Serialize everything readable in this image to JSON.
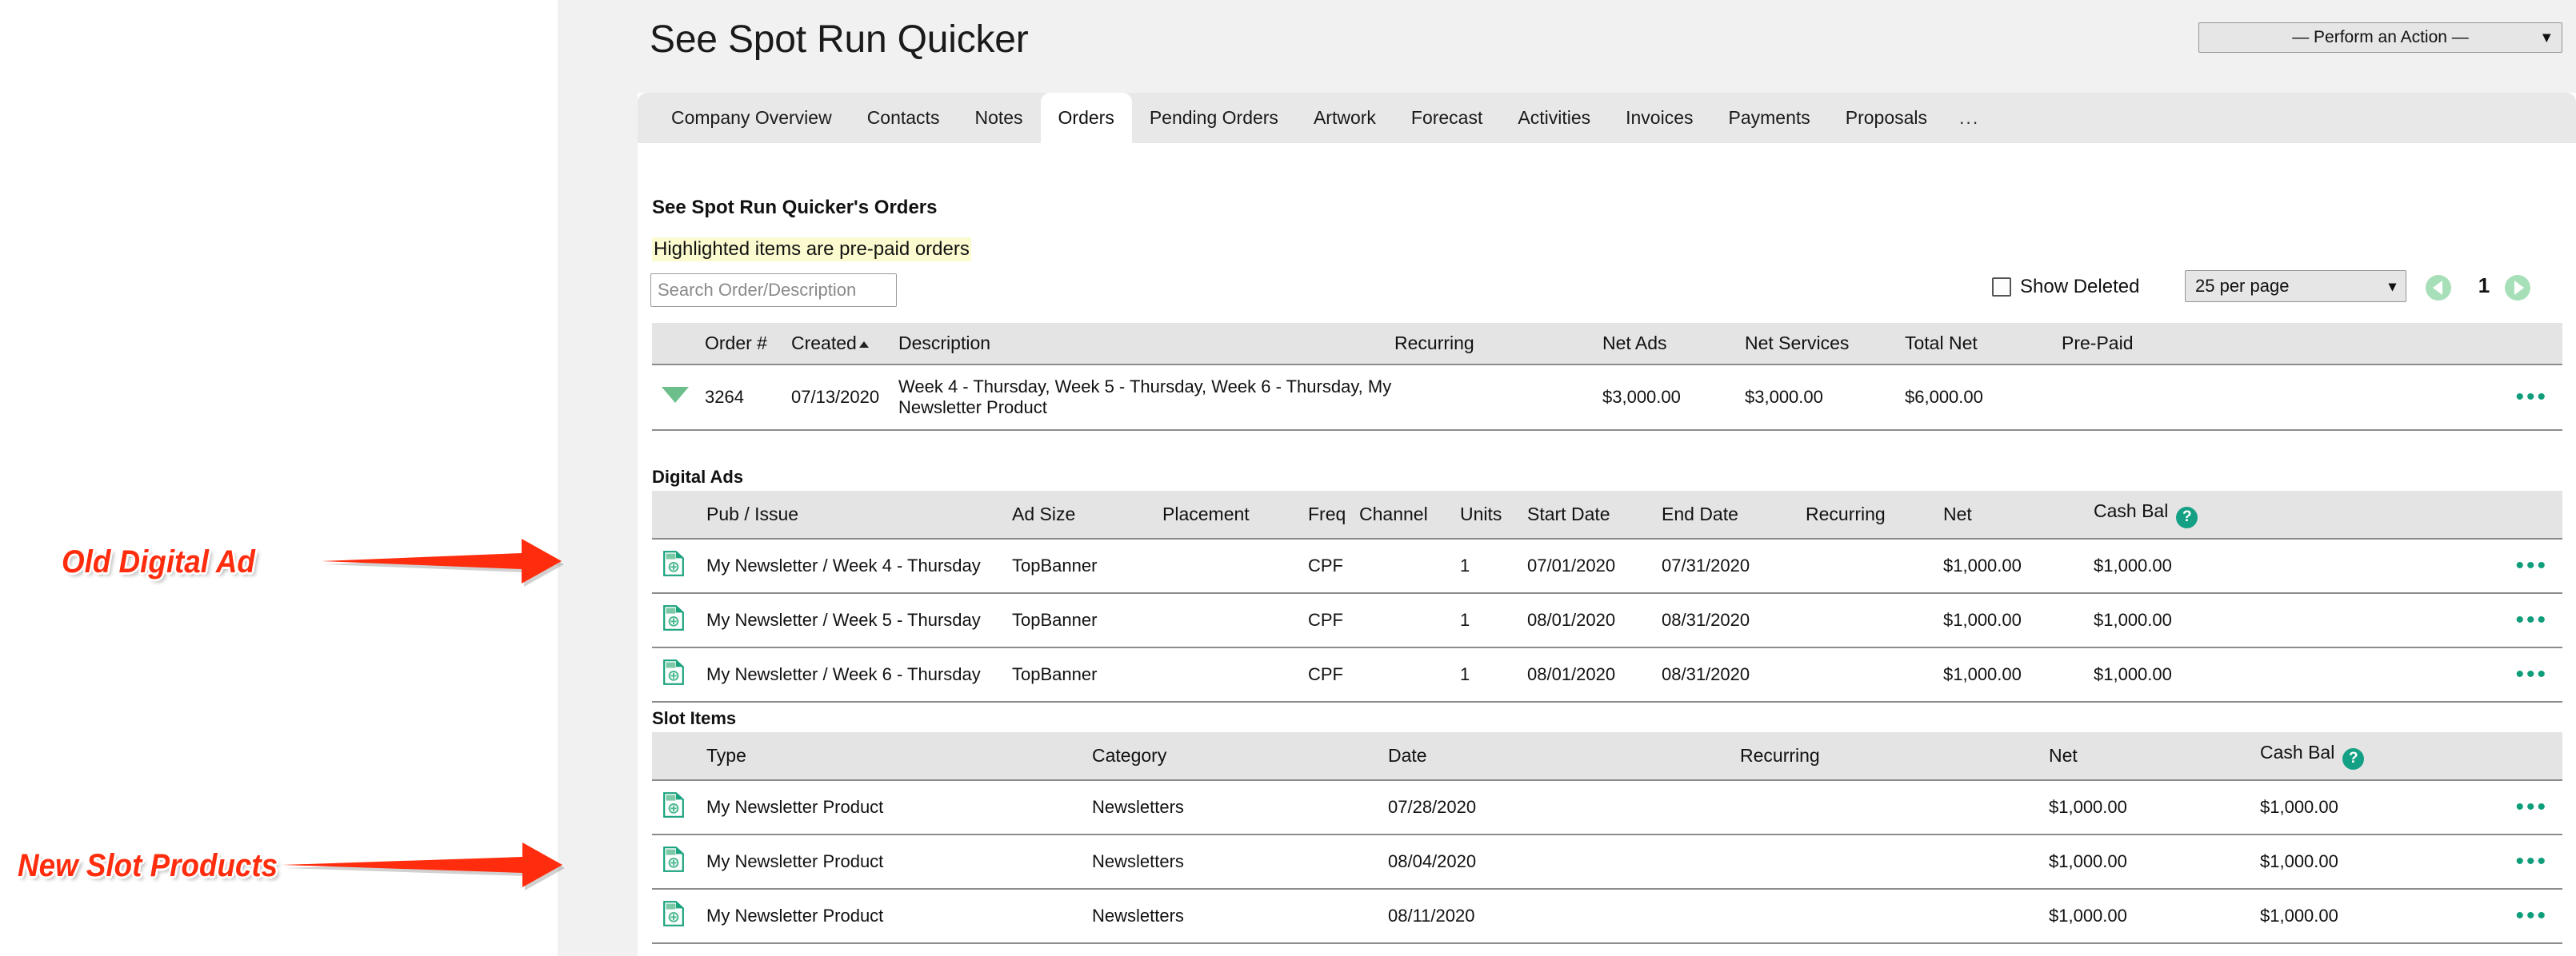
{
  "header": {
    "title": "See Spot Run Quicker",
    "action_select": {
      "value": "— Perform an Action —",
      "chevron": "chevron-down-icon"
    }
  },
  "tabs": [
    {
      "label": "Company Overview",
      "active": false
    },
    {
      "label": "Contacts",
      "active": false
    },
    {
      "label": "Notes",
      "active": false
    },
    {
      "label": "Orders",
      "active": true
    },
    {
      "label": "Pending Orders",
      "active": false
    },
    {
      "label": "Artwork",
      "active": false
    },
    {
      "label": "Forecast",
      "active": false
    },
    {
      "label": "Activities",
      "active": false
    },
    {
      "label": "Invoices",
      "active": false
    },
    {
      "label": "Payments",
      "active": false
    },
    {
      "label": "Proposals",
      "active": false
    },
    {
      "label": "...",
      "active": false
    }
  ],
  "orders_panel": {
    "heading": "See Spot Run Quicker's Orders",
    "prepaid_note": "Highlighted items are pre-paid orders",
    "search": {
      "value": "",
      "placeholder": "Search Order/Description"
    },
    "show_deleted_label": "Show Deleted",
    "per_page": "25 per page",
    "page_number": "1",
    "prev_label": "prev-page-arrow",
    "next_label": "next-page-arrow"
  },
  "orders_table": {
    "columns": [
      "",
      "Order #",
      "Created",
      "Description",
      "Recurring",
      "Net Ads",
      "Net Services",
      "Total Net",
      "Pre-Paid",
      ""
    ],
    "sorted_column": "Created",
    "rows": [
      {
        "order_no": "3264",
        "created": "07/13/2020",
        "description": "Week 4 - Thursday, Week 5 - Thursday, Week 6 - Thursday, My Newsletter Product",
        "recurring": "",
        "net_ads": "$3,000.00",
        "net_services": "$3,000.00",
        "total_net": "$6,000.00",
        "pre_paid": "",
        "actions": "•••"
      }
    ]
  },
  "digital_ads": {
    "section_label": "Digital Ads",
    "columns": [
      "",
      "Pub / Issue",
      "Ad Size",
      "Placement",
      "Freq",
      "Channel",
      "Units",
      "Start Date",
      "End Date",
      "Recurring",
      "Net",
      "Cash Bal",
      ""
    ],
    "cash_bal_help": "?",
    "rows": [
      {
        "icon": "document-add-icon",
        "pub_issue": "My Newsletter / Week 4 - Thursday",
        "ad_size": "TopBanner",
        "placement": "",
        "freq": "CPF",
        "channel": "",
        "units": "1",
        "start_date": "07/01/2020",
        "end_date": "07/31/2020",
        "recurring": "",
        "net": "$1,000.00",
        "cash_bal": "$1,000.00",
        "actions": "•••"
      },
      {
        "icon": "document-add-icon",
        "pub_issue": "My Newsletter / Week 5 - Thursday",
        "ad_size": "TopBanner",
        "placement": "",
        "freq": "CPF",
        "channel": "",
        "units": "1",
        "start_date": "08/01/2020",
        "end_date": "08/31/2020",
        "recurring": "",
        "net": "$1,000.00",
        "cash_bal": "$1,000.00",
        "actions": "•••"
      },
      {
        "icon": "document-add-icon",
        "pub_issue": "My Newsletter / Week 6 - Thursday",
        "ad_size": "TopBanner",
        "placement": "",
        "freq": "CPF",
        "channel": "",
        "units": "1",
        "start_date": "08/01/2020",
        "end_date": "08/31/2020",
        "recurring": "",
        "net": "$1,000.00",
        "cash_bal": "$1,000.00",
        "actions": "•••"
      }
    ]
  },
  "slot_items": {
    "section_label": "Slot Items",
    "columns": [
      "",
      "Type",
      "Category",
      "Date",
      "Recurring",
      "Net",
      "Cash Bal",
      ""
    ],
    "cash_bal_help": "?",
    "rows": [
      {
        "icon": "document-add-icon",
        "type": "My Newsletter Product",
        "category": "Newsletters",
        "date": "07/28/2020",
        "recurring": "",
        "net": "$1,000.00",
        "cash_bal": "$1,000.00",
        "actions": "•••"
      },
      {
        "icon": "document-add-icon",
        "type": "My Newsletter Product",
        "category": "Newsletters",
        "date": "08/04/2020",
        "recurring": "",
        "net": "$1,000.00",
        "cash_bal": "$1,000.00",
        "actions": "•••"
      },
      {
        "icon": "document-add-icon",
        "type": "My Newsletter Product",
        "category": "Newsletters",
        "date": "08/11/2020",
        "recurring": "",
        "net": "$1,000.00",
        "cash_bal": "$1,000.00",
        "actions": "•••"
      }
    ]
  },
  "annotations": [
    {
      "text": "Old Digital Ad",
      "color": "#ff2d0d"
    },
    {
      "text": "New Slot Products",
      "color": "#ff2d0d"
    }
  ]
}
